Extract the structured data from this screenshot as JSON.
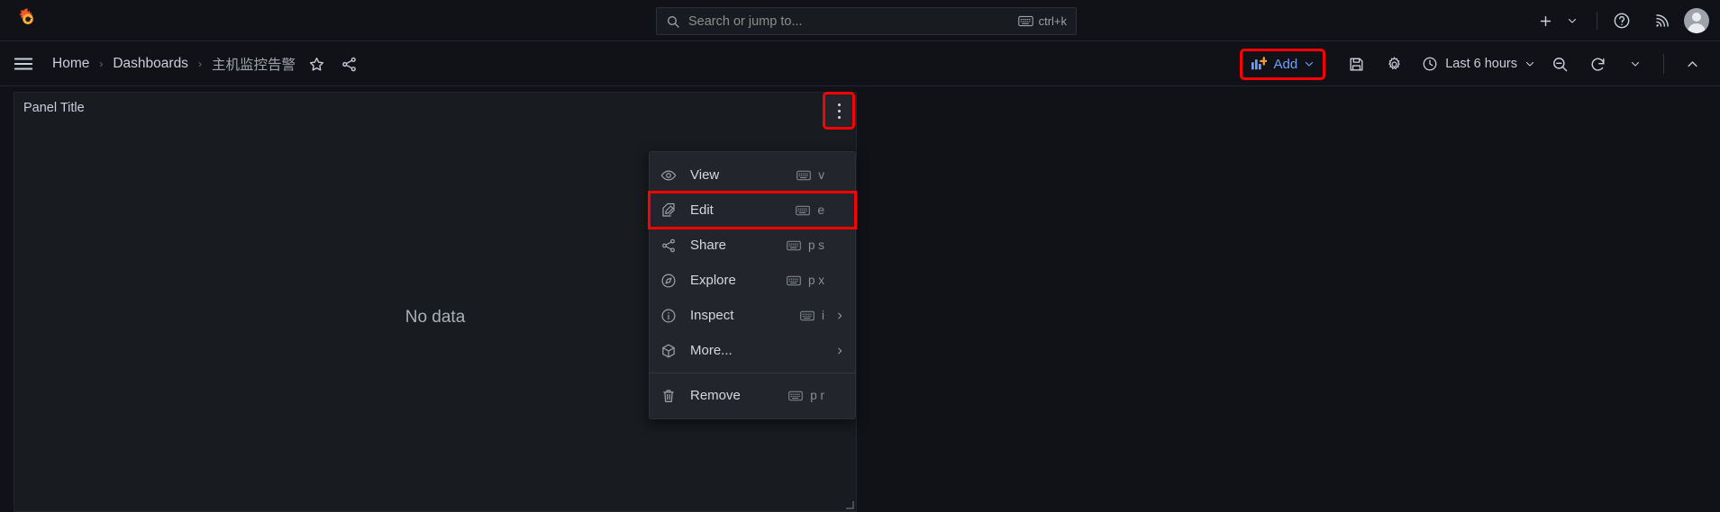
{
  "colors": {
    "app_bg": "#111217",
    "panel_bg": "#181b1f",
    "menu_bg": "#22252b",
    "accent_blue": "#6e9fff",
    "highlight_red": "#ff0000",
    "logo_orange": "#f05a28",
    "logo_yellow": "#fbad37",
    "text_primary": "#ccccdc",
    "text_secondary": "#9fa3ab"
  },
  "topbar": {
    "logo_name": "grafana-logo",
    "search": {
      "placeholder": "Search or jump to...",
      "icon": "search-icon",
      "shortcut": "ctrl+k",
      "shortcut_icon": "keyboard-icon"
    },
    "actions": [
      {
        "name": "create-new-button",
        "icon": "plus-icon",
        "label": ""
      },
      {
        "name": "create-new-chevron",
        "icon": "chevron-down-icon",
        "label": ""
      },
      {
        "name": "help-button",
        "icon": "question-circle-icon",
        "label": ""
      },
      {
        "name": "news-button",
        "icon": "rss-icon",
        "label": ""
      },
      {
        "name": "user-avatar",
        "icon": "avatar-icon",
        "label": ""
      }
    ]
  },
  "navrow": {
    "menu_toggle_icon": "hamburger-icon",
    "breadcrumb": [
      {
        "label": "Home",
        "current": false
      },
      {
        "label": "Dashboards",
        "current": false
      },
      {
        "label": "主机监控告警",
        "current": true
      }
    ],
    "separator": "›",
    "breadcrumb_actions": [
      {
        "name": "favorite-dashboard-button",
        "icon": "star-icon"
      },
      {
        "name": "share-dashboard-button",
        "icon": "share-nodes-icon"
      }
    ],
    "add_button": {
      "label": "Add",
      "icon": "add-panel-icon",
      "chevron": "chevron-down-icon",
      "highlighted": true
    },
    "toolbar_actions": [
      {
        "name": "save-dashboard-button",
        "icon": "save-icon"
      },
      {
        "name": "dashboard-settings-button",
        "icon": "gear-icon"
      }
    ],
    "time_picker": {
      "icon": "clock-icon",
      "label": "Last 6 hours",
      "chevron": "chevron-down-icon"
    },
    "zoom_out_button": {
      "name": "zoom-out-time-range-button",
      "icon": "zoom-out-icon"
    },
    "refresh_button": {
      "name": "refresh-dashboard-button",
      "icon": "refresh-icon"
    },
    "refresh_interval_chevron": {
      "name": "refresh-interval-chevron",
      "icon": "chevron-down-icon"
    },
    "collapse_button": {
      "name": "collapse-toolbar-button",
      "icon": "chevron-up-icon"
    }
  },
  "panel": {
    "title": "Panel Title",
    "no_data_text": "No data",
    "kebab": {
      "name": "panel-menu-button",
      "icon": "kebab-vertical-icon",
      "highlighted": true
    },
    "resize_handle_icon": "resize-corner-icon"
  },
  "context_menu": {
    "items": [
      {
        "label": "View",
        "icon": "eye-icon",
        "shortcut": "v",
        "kb_icon": "keyboard-icon",
        "submenu": false,
        "highlighted": false
      },
      {
        "label": "Edit",
        "icon": "pencil-icon",
        "shortcut": "e",
        "kb_icon": "keyboard-icon",
        "submenu": false,
        "highlighted": true
      },
      {
        "label": "Share",
        "icon": "share-icon",
        "shortcut": "p s",
        "kb_icon": "keyboard-icon",
        "submenu": false,
        "highlighted": false
      },
      {
        "label": "Explore",
        "icon": "compass-icon",
        "shortcut": "p x",
        "kb_icon": "keyboard-icon",
        "submenu": false,
        "highlighted": false
      },
      {
        "label": "Inspect",
        "icon": "info-icon",
        "shortcut": "i",
        "kb_icon": "keyboard-icon",
        "submenu": true,
        "highlighted": false
      },
      {
        "label": "More...",
        "icon": "cube-icon",
        "shortcut": "",
        "kb_icon": "",
        "submenu": true,
        "highlighted": false
      }
    ],
    "remove_item": {
      "label": "Remove",
      "icon": "trash-icon",
      "shortcut": "p r",
      "kb_icon": "keyboard-icon",
      "submenu": false,
      "highlighted": false
    }
  }
}
